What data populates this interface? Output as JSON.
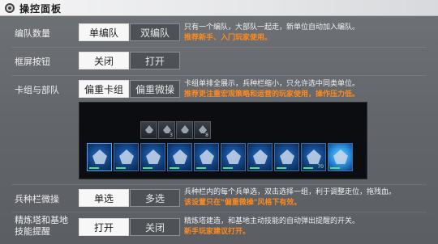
{
  "title": "操控面板",
  "rows": [
    {
      "label": "编队数量",
      "options": [
        "单编队",
        "双编队"
      ],
      "selected": 0,
      "desc": [
        "只有一个编队，大部队一起走，新单位自动加入编队。"
      ],
      "hint": "推荐新手、入门玩家使用。"
    },
    {
      "label": "框屏按钮",
      "options": [
        "关闭",
        "打开"
      ],
      "selected": 0,
      "desc": [],
      "hint": ""
    },
    {
      "label": "卡组与部队",
      "options": [
        "偏重卡组",
        "偏重微操"
      ],
      "selected": 0,
      "desc": [
        "卡组单排全展示，兵种栏缩小，只允许选中同类单位。"
      ],
      "hint": "推荐更注重宏观策略和运营的玩家使用，操作压力低。"
    },
    {
      "label": "兵种栏微操",
      "options": [
        "单选",
        "多选"
      ],
      "selected": 0,
      "desc": [
        "兵种栏内的每个兵单选，双击选择一组，利于调整走位，拖残血。"
      ],
      "hint": "该设置只在\"偏重微操\"风格下有效。"
    },
    {
      "label": "精炼塔和基地技能提醒",
      "options": [
        "打开",
        "关闭"
      ],
      "selected": 0,
      "desc": [
        "精炼塔建造，和基地主动技能的自动弹出提醒的开关。"
      ],
      "hint": "新手玩家建议打开。"
    }
  ],
  "preview": {
    "mini_levels": [
      "",
      "3",
      "",
      "8"
    ],
    "card_levels": [
      "",
      "",
      "",
      "",
      "",
      "",
      "",
      "",
      "70",
      "",
      "",
      ""
    ]
  },
  "colors": {
    "hint": "#ff8a1c",
    "selected_bg": "#f7f7f8",
    "unselected_bg": "#4e5156"
  }
}
